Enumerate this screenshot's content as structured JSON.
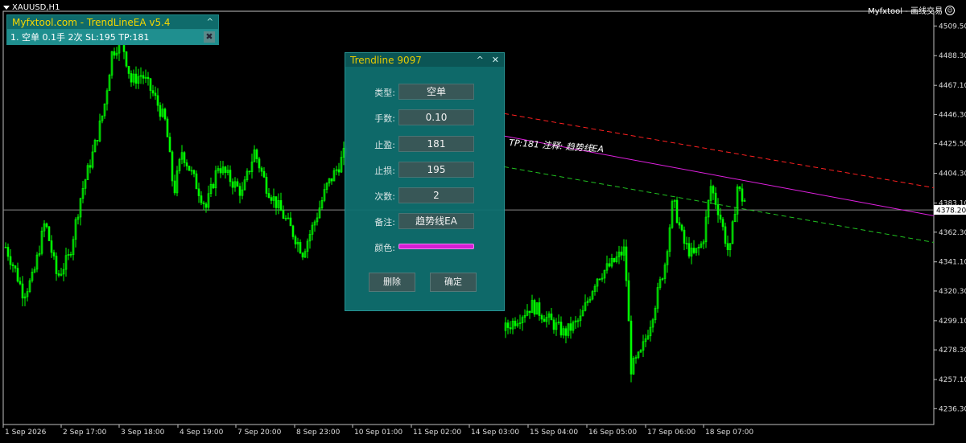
{
  "symbol_label": "XAUUSD,H1",
  "ea_label": "Myfxtool - 画线交易",
  "ea_panel": {
    "title": "Myfxtool.com - TrendLineEA  v5.4",
    "collapse_icon": "^",
    "row_text": "1.  空单   0.1手   2次   SL:195   TP:181",
    "delete_icon": "✖"
  },
  "dialog": {
    "title": "Trendline 9097",
    "fields": [
      {
        "label": "类型:",
        "value": "空单"
      },
      {
        "label": "手数:",
        "value": "0.10"
      },
      {
        "label": "止盈:",
        "value": "181"
      },
      {
        "label": "止损:",
        "value": "195"
      },
      {
        "label": "次数:",
        "value": "2"
      },
      {
        "label": "备注:",
        "value": "趋势线EA"
      }
    ],
    "color_label": "颜色:",
    "line_color": "#e020e0",
    "delete_label": "删除",
    "ok_label": "确定",
    "ghost_text": "0.1手   2次   SL:195"
  },
  "annotation": "TP:181   注释: 趋势线EA",
  "current_price": "4378.20",
  "colors": {
    "bull": "#00ff00",
    "bear": "#00ff00",
    "trend": "#e020e0",
    "sl": "#ff2020",
    "tp": "#20c020",
    "grid": "#c0c0c0"
  },
  "chart_data": {
    "type": "candlestick",
    "ylim": [
      4225,
      4520
    ],
    "yticks": [
      "4509.50",
      "4488.30",
      "4467.10",
      "4446.30",
      "4425.50",
      "4404.30",
      "4383.10",
      "4362.30",
      "4341.10",
      "4320.30",
      "4299.10",
      "4278.30",
      "4257.10",
      "4236.30"
    ],
    "xticks": [
      "1 Sep 2026",
      "2 Sep 17:00",
      "3 Sep 18:00",
      "4 Sep 19:00",
      "7 Sep 20:00",
      "8 Sep 23:00",
      "10 Sep 01:00",
      "11 Sep 02:00",
      "14 Sep 03:00",
      "15 Sep 04:00",
      "16 Sep 05:00",
      "17 Sep 06:00",
      "18 Sep 07:00"
    ],
    "current_price": 4378.2,
    "path_points": [
      [
        0,
        4360
      ],
      [
        18,
        4335
      ],
      [
        28,
        4318
      ],
      [
        40,
        4330
      ],
      [
        55,
        4370
      ],
      [
        70,
        4330
      ],
      [
        85,
        4345
      ],
      [
        100,
        4390
      ],
      [
        115,
        4420
      ],
      [
        128,
        4450
      ],
      [
        138,
        4490
      ],
      [
        150,
        4500
      ],
      [
        162,
        4470
      ],
      [
        175,
        4475
      ],
      [
        190,
        4460
      ],
      [
        205,
        4440
      ],
      [
        215,
        4390
      ],
      [
        225,
        4420
      ],
      [
        240,
        4400
      ],
      [
        255,
        4380
      ],
      [
        270,
        4410
      ],
      [
        285,
        4400
      ],
      [
        300,
        4390
      ],
      [
        315,
        4420
      ],
      [
        330,
        4395
      ],
      [
        345,
        4380
      ],
      [
        360,
        4365
      ],
      [
        375,
        4348
      ],
      [
        390,
        4370
      ],
      [
        405,
        4395
      ],
      [
        420,
        4410
      ],
      [
        432,
        4425
      ],
      [
        470,
        4400
      ],
      [
        530,
        4310
      ],
      [
        560,
        4320
      ],
      [
        600,
        4300
      ],
      [
        620,
        4290
      ],
      [
        640,
        4300
      ],
      [
        660,
        4310
      ],
      [
        680,
        4300
      ],
      [
        700,
        4290
      ],
      [
        720,
        4300
      ],
      [
        740,
        4330
      ],
      [
        760,
        4340
      ],
      [
        775,
        4350
      ],
      [
        783,
        4265
      ],
      [
        795,
        4275
      ],
      [
        808,
        4300
      ],
      [
        825,
        4340
      ],
      [
        835,
        4385
      ],
      [
        848,
        4355
      ],
      [
        860,
        4345
      ],
      [
        872,
        4355
      ],
      [
        882,
        4395
      ],
      [
        893,
        4375
      ],
      [
        905,
        4345
      ],
      [
        915,
        4395
      ],
      [
        922,
        4385
      ]
    ],
    "trendline": {
      "label": "TP:181",
      "points": [
        [
          626,
          4431
        ],
        [
          1160,
          4374
        ]
      ]
    },
    "sl_line": {
      "points": [
        [
          626,
          4447
        ],
        [
          1160,
          4394
        ]
      ]
    },
    "tp_line": {
      "points": [
        [
          626,
          4409
        ],
        [
          1160,
          4355
        ]
      ]
    }
  }
}
